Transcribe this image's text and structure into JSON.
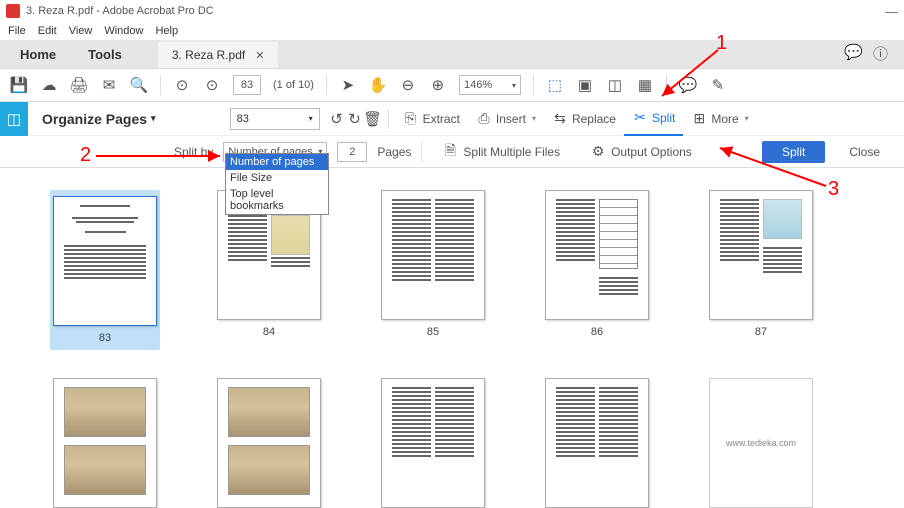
{
  "title": "3. Reza R.pdf - Adobe Acrobat Pro DC",
  "menu": {
    "file": "File",
    "edit": "Edit",
    "view": "View",
    "window": "Window",
    "help": "Help"
  },
  "tabs": {
    "home": "Home",
    "tools": "Tools",
    "doc": "3. Reza R.pdf"
  },
  "toolbar": {
    "page_current": "83",
    "page_of": "(1 of 10)",
    "zoom": "146%"
  },
  "organize": {
    "title": "Organize Pages",
    "page_sel": "83",
    "extract": "Extract",
    "insert": "Insert",
    "replace": "Replace",
    "split": "Split",
    "more": "More"
  },
  "split": {
    "label": "Split by",
    "mode": "Number of pages",
    "num": "2",
    "pages": "Pages",
    "multiple": "Split Multiple Files",
    "output": "Output Options",
    "btn": "Split",
    "close": "Close"
  },
  "dropdown_options": [
    "Number of pages",
    "File Size",
    "Top level bookmarks"
  ],
  "thumbs": {
    "p1": "83",
    "p2": "84",
    "p3": "85",
    "p4": "86",
    "p5": "87"
  },
  "watermark": "www.tedieka.com",
  "annotations": {
    "a1": "1",
    "a2": "2",
    "a3": "3"
  }
}
